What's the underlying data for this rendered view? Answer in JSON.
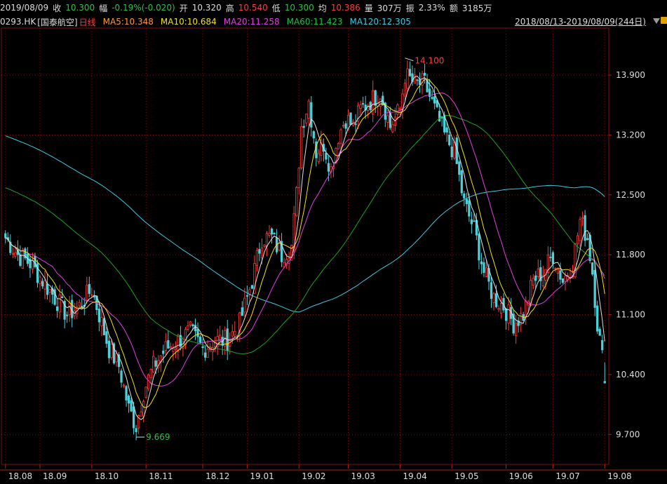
{
  "header": {
    "date": "2019/08/09",
    "close_label": "收",
    "close": "10.300",
    "change_label": "幅",
    "change": "-0.19%(-0.020)",
    "open_label": "开",
    "open": "10.320",
    "high_label": "高",
    "high": "10.540",
    "low_label": "低",
    "low": "10.300",
    "avg_label": "均",
    "avg": "10.386",
    "vol_label": "量",
    "vol": "307万",
    "amp_label": "振",
    "amp": "2.33%",
    "amt_label": "额",
    "amt": "3185万"
  },
  "ma_bar": {
    "code": "0293.HK",
    "name": "[国泰航空]",
    "period": "日线",
    "ma5": "MA5:10.348",
    "ma10": "MA10:10.684",
    "ma20": "MA20:11.258",
    "ma60": "MA60:11.423",
    "ma120": "MA120:12.305",
    "range": "2018/08/13-2019/08/09(244日)"
  },
  "colors": {
    "up": "#ff3b3b",
    "down": "#4fd0d8",
    "ma5": "#e0e0e0",
    "ma10": "#f0e020",
    "ma20": "#e040e0",
    "ma60": "#20a020",
    "ma120": "#40c8e0",
    "grid": "#7a1010"
  },
  "chart_data": {
    "type": "candlestick",
    "ylim": [
      9.35,
      14.45
    ],
    "y_ticks": [
      "13.900",
      "13.200",
      "12.500",
      "11.800",
      "11.100",
      "10.400",
      "9.700"
    ],
    "y_tick_values": [
      13.9,
      13.2,
      12.5,
      11.8,
      11.1,
      10.4,
      9.7
    ],
    "x_ticks": [
      "18.08",
      "18.09",
      "18.10",
      "18.11",
      "18.12",
      "19.01",
      "19.02",
      "19.03",
      "19.04",
      "19.05",
      "19.06",
      "19.07",
      "19.08"
    ],
    "x_tick_index": [
      0,
      14,
      35,
      57,
      80,
      98,
      119,
      139,
      160,
      181,
      203,
      222,
      243
    ],
    "annotations": {
      "max": "14.100",
      "min": "9.669",
      "max_index": 162,
      "min_index": 53
    },
    "anchors": [
      [
        0,
        12.0
      ],
      [
        5,
        11.8
      ],
      [
        10,
        11.7
      ],
      [
        15,
        11.5
      ],
      [
        20,
        11.3
      ],
      [
        25,
        11.1
      ],
      [
        30,
        11.2
      ],
      [
        35,
        11.4
      ],
      [
        38,
        11.1
      ],
      [
        42,
        10.7
      ],
      [
        46,
        10.5
      ],
      [
        50,
        10.0
      ],
      [
        53,
        9.8
      ],
      [
        56,
        10.2
      ],
      [
        60,
        10.5
      ],
      [
        65,
        10.7
      ],
      [
        70,
        10.8
      ],
      [
        75,
        10.9
      ],
      [
        80,
        10.7
      ],
      [
        85,
        10.8
      ],
      [
        90,
        10.8
      ],
      [
        95,
        11.0
      ],
      [
        100,
        11.5
      ],
      [
        104,
        12.0
      ],
      [
        108,
        12.0
      ],
      [
        112,
        11.8
      ],
      [
        116,
        11.9
      ],
      [
        118,
        12.5
      ],
      [
        120,
        13.3
      ],
      [
        123,
        13.6
      ],
      [
        126,
        13.0
      ],
      [
        129,
        13.1
      ],
      [
        132,
        12.8
      ],
      [
        135,
        13.2
      ],
      [
        138,
        13.4
      ],
      [
        141,
        13.3
      ],
      [
        144,
        13.5
      ],
      [
        148,
        13.6
      ],
      [
        152,
        13.7
      ],
      [
        156,
        13.3
      ],
      [
        160,
        13.5
      ],
      [
        162,
        13.9
      ],
      [
        166,
        13.8
      ],
      [
        170,
        13.8
      ],
      [
        174,
        13.5
      ],
      [
        178,
        13.2
      ],
      [
        182,
        13.0
      ],
      [
        186,
        12.4
      ],
      [
        190,
        12.1
      ],
      [
        194,
        11.6
      ],
      [
        198,
        11.3
      ],
      [
        202,
        11.2
      ],
      [
        206,
        11.0
      ],
      [
        210,
        11.1
      ],
      [
        214,
        11.5
      ],
      [
        218,
        11.6
      ],
      [
        222,
        11.8
      ],
      [
        226,
        11.5
      ],
      [
        230,
        11.7
      ],
      [
        233,
        12.2
      ],
      [
        236,
        12.0
      ],
      [
        238,
        11.6
      ],
      [
        240,
        11.0
      ],
      [
        242,
        10.6
      ],
      [
        243,
        10.3
      ]
    ],
    "ma_final": {
      "ma5": 10.348,
      "ma10": 10.684,
      "ma20": 11.258,
      "ma60": 11.423,
      "ma120": 12.305
    }
  }
}
